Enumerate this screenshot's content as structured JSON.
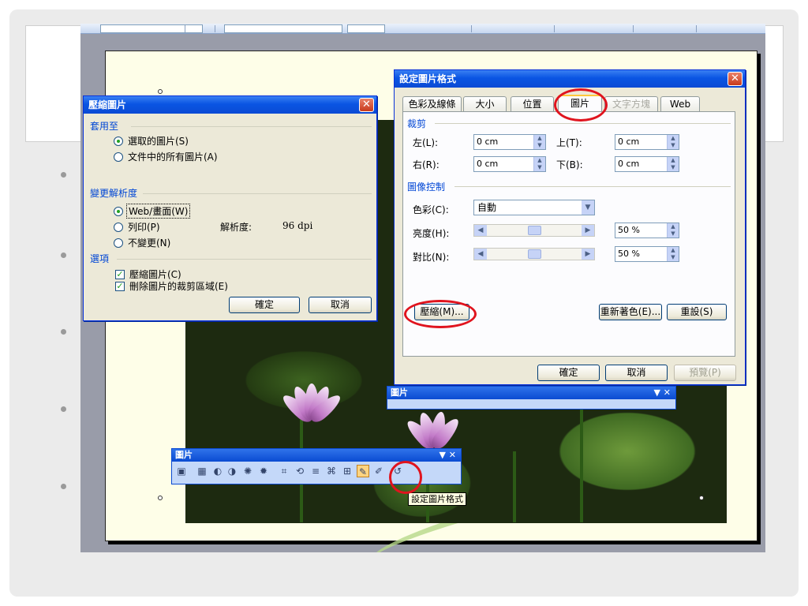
{
  "compress_dialog": {
    "title": "壓縮圖片",
    "apply_to_label": "套用至",
    "apply_options": [
      "選取的圖片(S)",
      "文件中的所有圖片(A)"
    ],
    "resolution_label": "變更解析度",
    "resolution_options": [
      "Web/畫面(W)",
      "列印(P)",
      "不變更(N)"
    ],
    "resolution_value_label": "解析度:",
    "resolution_value": "96 dpi",
    "options_label": "選項",
    "option_checks": [
      "壓縮圖片(C)",
      "刪除圖片的裁剪區域(E)"
    ],
    "ok": "確定",
    "cancel": "取消"
  },
  "format_dialog": {
    "title": "設定圖片格式",
    "tabs": [
      "色彩及線條",
      "大小",
      "位置",
      "圖片",
      "文字方塊",
      "Web"
    ],
    "crop_label": "裁剪",
    "left_label": "左(L):",
    "left_value": "0 cm",
    "top_label": "上(T):",
    "top_value": "0 cm",
    "right_label": "右(R):",
    "right_value": "0 cm",
    "bottom_label": "下(B):",
    "bottom_value": "0 cm",
    "image_control_label": "圖像控制",
    "color_label": "色彩(C):",
    "color_value": "自動",
    "brightness_label": "亮度(H):",
    "brightness_value": "50 %",
    "contrast_label": "對比(N):",
    "contrast_value": "50 %",
    "compress_button": "壓縮(M)...",
    "recolor_button": "重新著色(E)...",
    "reset_button": "重設(S)",
    "ok": "確定",
    "cancel": "取消",
    "preview": "預覽(P)"
  },
  "picture_toolbar_top": {
    "title": "圖片"
  },
  "picture_toolbar_bottom": {
    "title": "圖片"
  },
  "tooltip": "設定圖片格式",
  "colors": {
    "title_blue": "#0a55e3",
    "dialog_bg": "#ece9d8",
    "highlight_red": "#e0141e"
  }
}
